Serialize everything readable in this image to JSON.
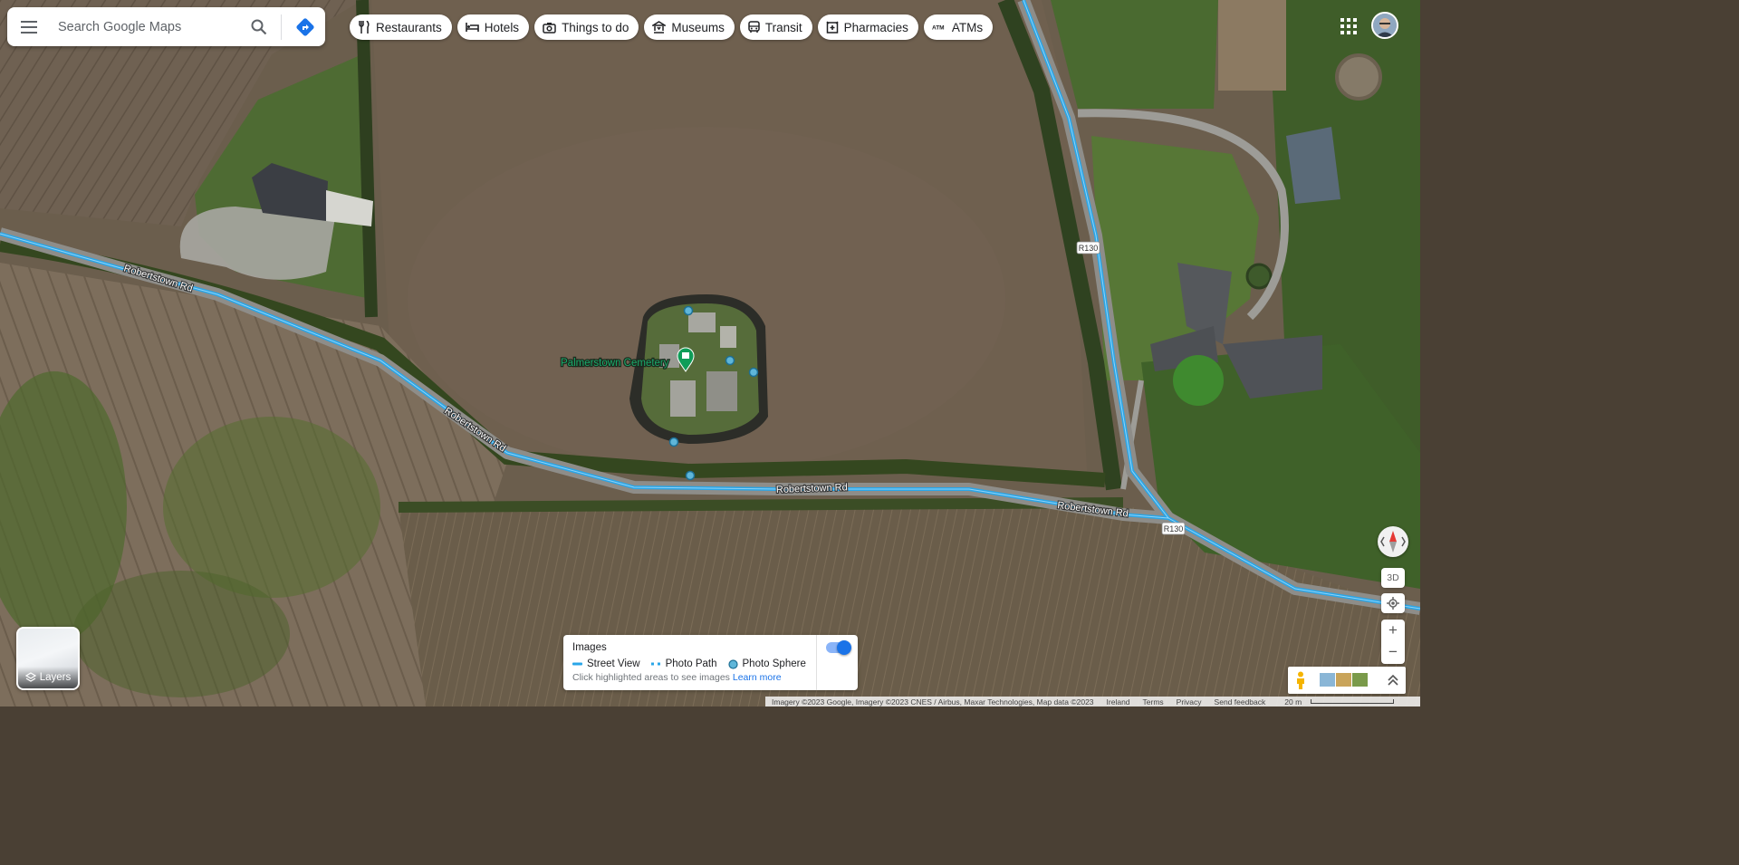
{
  "search": {
    "placeholder": "Search Google Maps"
  },
  "chips": [
    {
      "label": "Restaurants",
      "icon": "fork-knife-icon"
    },
    {
      "label": "Hotels",
      "icon": "bed-icon"
    },
    {
      "label": "Things to do",
      "icon": "camera-icon"
    },
    {
      "label": "Museums",
      "icon": "museum-icon"
    },
    {
      "label": "Transit",
      "icon": "bus-icon"
    },
    {
      "label": "Pharmacies",
      "icon": "pharmacy-icon"
    },
    {
      "label": "ATMs",
      "icon": "atm-icon"
    }
  ],
  "map": {
    "place_label": "Palmerstown Cemetery",
    "road_labels": [
      "Robertstown Rd",
      "Robertstown Rd",
      "Robertstown Rd",
      "Robertstown Rd"
    ],
    "route_badges": [
      "R130",
      "R130"
    ],
    "colors": {
      "street_view_line": "#29a6e8",
      "accent": "#1a73e8"
    }
  },
  "layers": {
    "label": "Layers"
  },
  "images_panel": {
    "title": "Images",
    "legend": [
      "Street View",
      "Photo Path",
      "Photo Sphere"
    ],
    "hint": "Click highlighted areas to see images",
    "learn_more": "Learn more",
    "toggle_on": true
  },
  "controls": {
    "three_d": "3D",
    "zoom_in": "+",
    "zoom_out": "−"
  },
  "footer": {
    "attribution": "Imagery ©2023 Google, Imagery ©2023 CNES / Airbus, Maxar Technologies, Map data ©2023",
    "country": "Ireland",
    "terms": "Terms",
    "privacy": "Privacy",
    "feedback": "Send feedback",
    "scale": "20 m"
  }
}
